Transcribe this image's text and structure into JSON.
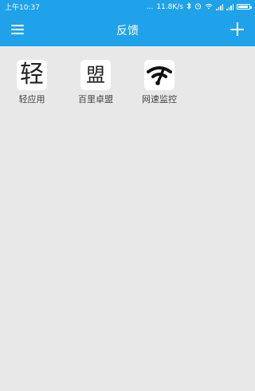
{
  "status_bar": {
    "time": "上午10:37",
    "dots": "...",
    "net_speed": "11.8K/s",
    "bluetooth_icon": "bluetooth-icon",
    "wifi_icon": "wifi-icon",
    "alarm_icon": "alarm-icon",
    "battery_icon": "battery-icon"
  },
  "app_bar": {
    "title": "反馈",
    "menu_icon": "menu-icon",
    "add_icon": "plus-icon",
    "background": "#1fa2e9"
  },
  "apps": [
    {
      "label": "轻应用",
      "icon_glyph": "轻"
    },
    {
      "label": "百里卓盟",
      "icon_glyph": "盟"
    },
    {
      "label": "网速监控",
      "icon_name": "speed-monitor-icon"
    }
  ]
}
